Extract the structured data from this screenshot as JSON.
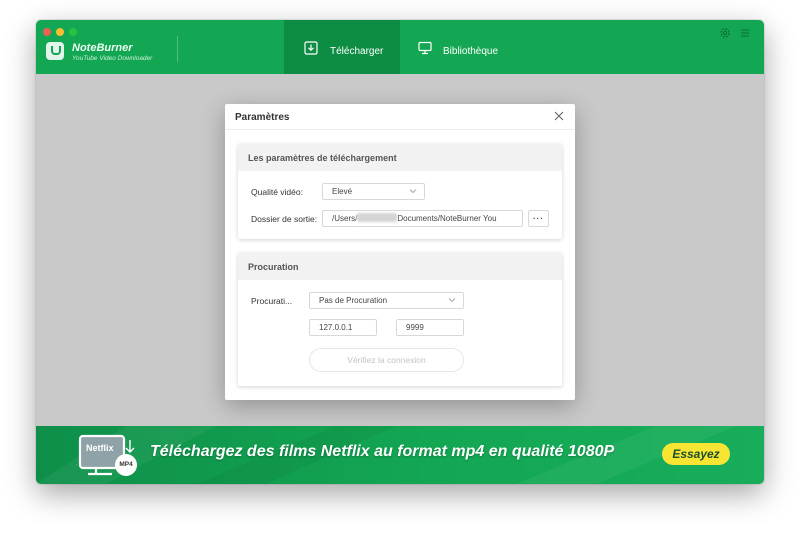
{
  "app": {
    "name": "NoteBurner",
    "subtitle": "YouTube Video Downloader",
    "tabs": [
      {
        "label": "Télécharger",
        "icon": "download-icon",
        "active": true
      },
      {
        "label": "Bibliothèque",
        "icon": "monitor-icon",
        "active": false
      }
    ],
    "icons": [
      "gear-icon",
      "menu-icon"
    ]
  },
  "dialog": {
    "title": "Paramètres",
    "download_section": {
      "title": "Les paramètres de téléchargement",
      "quality_label": "Qualité vidéo:",
      "quality_value": "Elevé",
      "output_label": "Dossier de sortie:",
      "output_prefix": "/Users/",
      "output_suffix": "Documents/NoteBurner You",
      "browse_label": "···"
    },
    "proxy_section": {
      "title": "Procuration",
      "proxy_label": "Procurati...",
      "proxy_value": "Pas de Procuration",
      "host_value": "127.0.0.1",
      "port_value": "9999",
      "verify_label": "Vérifiez la connexion"
    }
  },
  "banner": {
    "tv_label": "Netflix",
    "badge": "MP4",
    "text": "Téléchargez des films Netflix au format mp4 en qualité 1080P",
    "button": "Essayez"
  },
  "colors": {
    "brand_green": "#13a753",
    "active_tab": "#0d8d44",
    "overlay": "#c9c9c9",
    "button_yellow": "#f7e534"
  }
}
